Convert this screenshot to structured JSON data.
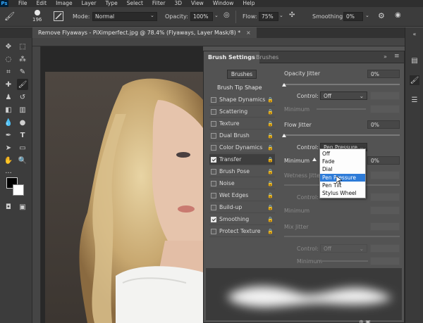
{
  "menu": [
    "File",
    "Edit",
    "Image",
    "Layer",
    "Type",
    "Select",
    "Filter",
    "3D",
    "View",
    "Window",
    "Help"
  ],
  "options_bar": {
    "brush_size": "196",
    "mode_label": "Mode:",
    "mode_value": "Normal",
    "opacity_label": "Opacity:",
    "opacity_value": "100%",
    "flow_label": "Flow:",
    "flow_value": "75%",
    "smoothing_label": "Smoothing:",
    "smoothing_value": "0%"
  },
  "document_tab": {
    "title": "Remove Flyaways - PiXimperfect.jpg @ 78.4% (Flyaways, Layer Mask/8) *",
    "close": "×"
  },
  "panel": {
    "tabs": [
      "Brush Settings",
      "Brushes"
    ],
    "brushes_button": "Brushes",
    "brush_tip_shape": "Brush Tip Shape",
    "items": [
      {
        "label": "Shape Dynamics",
        "checked": false
      },
      {
        "label": "Scattering",
        "checked": false
      },
      {
        "label": "Texture",
        "checked": false
      },
      {
        "label": "Dual Brush",
        "checked": false
      },
      {
        "label": "Color Dynamics",
        "checked": false
      },
      {
        "label": "Transfer",
        "checked": true
      },
      {
        "label": "Brush Pose",
        "checked": false
      },
      {
        "label": "Noise",
        "checked": false
      },
      {
        "label": "Wet Edges",
        "checked": false
      },
      {
        "label": "Build-up",
        "checked": false
      },
      {
        "label": "Smoothing",
        "checked": true
      },
      {
        "label": "Protect Texture",
        "checked": false
      }
    ],
    "settings": {
      "opacity_jitter_label": "Opacity Jitter",
      "opacity_jitter_value": "0%",
      "control_label": "Control:",
      "control1_value": "Off",
      "minimum_label": "Minimum",
      "flow_jitter_label": "Flow Jitter",
      "flow_jitter_value": "0%",
      "control2_value": "Pen Pressure",
      "minimum2_value": "0%",
      "wetness_jitter_label": "Wetness Jitter",
      "mix_jitter_label": "Mix Jitter",
      "control5_value": "Off"
    },
    "dropdown_options": [
      "Off",
      "Fade",
      "Dial",
      "Pen Pressure",
      "Pen Tilt",
      "Stylus Wheel"
    ],
    "dropdown_highlight": "Pen Pressure"
  },
  "colors": {
    "highlight": "#2d7bd8",
    "panel_bg": "#535353",
    "app_bg": "#3c3c3c"
  },
  "icons": {
    "toolbar": [
      "move-icon",
      "artboard-icon",
      "lasso-icon",
      "magic-wand-icon",
      "crop-icon",
      "eyedropper-icon",
      "healing-icon",
      "brush-icon",
      "stamp-icon",
      "history-brush-icon",
      "eraser-icon",
      "gradient-icon",
      "blur-icon",
      "dodge-icon",
      "pen-icon",
      "type-icon",
      "path-select-icon",
      "rectangle-icon",
      "hand-icon",
      "zoom-icon"
    ]
  }
}
